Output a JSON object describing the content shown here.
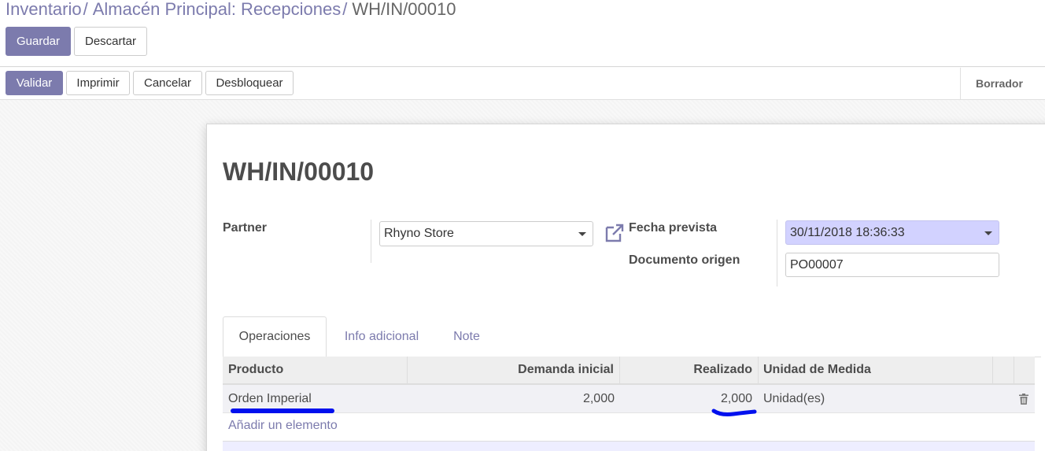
{
  "breadcrumb": {
    "items": [
      "Inventario",
      "Almacén Principal: Recepciones"
    ],
    "separator": "/",
    "current": "WH/IN/00010"
  },
  "control": {
    "save_label": "Guardar",
    "discard_label": "Descartar"
  },
  "statusbar": {
    "validate_label": "Validar",
    "print_label": "Imprimir",
    "cancel_label": "Cancelar",
    "unlock_label": "Desbloquear",
    "stage": "Borrador"
  },
  "form": {
    "title": "WH/IN/00010",
    "partner_label": "Partner",
    "partner_value": "Rhyno Store",
    "scheduled_label": "Fecha prevista",
    "scheduled_value": "30/11/2018 18:36:33",
    "origin_label": "Documento origen",
    "origin_value": "PO00007"
  },
  "tabs": [
    {
      "label": "Operaciones",
      "active": true
    },
    {
      "label": "Info adicional",
      "active": false
    },
    {
      "label": "Note",
      "active": false
    }
  ],
  "table": {
    "columns": [
      "Producto",
      "Demanda inicial",
      "Realizado",
      "Unidad de Medida"
    ],
    "rows": [
      {
        "product": "Orden Imperial",
        "demand": "2,000",
        "done": "2,000",
        "uom": "Unidad(es)"
      }
    ],
    "add_line_label": "Añadir un elemento"
  },
  "colors": {
    "brand": "#7c7bad",
    "annotation": "#0010ee",
    "date_field_bg": "#d2d2ff"
  },
  "icons": [
    "external-link-icon",
    "dropdown-caret-icon",
    "trash-icon"
  ]
}
